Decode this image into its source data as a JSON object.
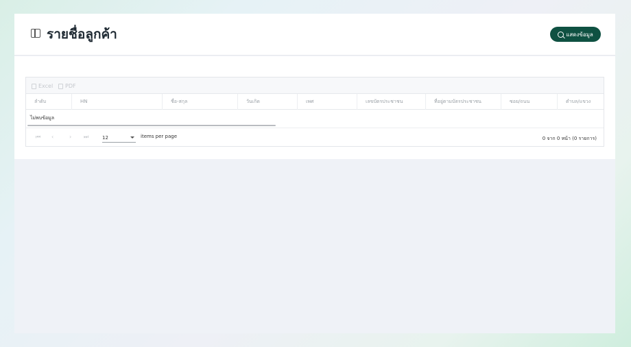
{
  "header": {
    "title": "รายชื่อลูกค้า",
    "show_button_label": "แสดงข้อมูล"
  },
  "toolbar": {
    "excel_label": "Excel",
    "pdf_label": "PDF"
  },
  "table": {
    "columns": [
      "ลำดับ",
      "HN",
      "ชื่อ-สกุล",
      "วันเกิด",
      "เพศ",
      "เลขบัตรประชาชน",
      "ที่อยู่ตามบัตรประชาชน",
      "ซอย/ถนน",
      "ตำบล/แขวง"
    ],
    "empty_message": "ไม่พบข้อมูล"
  },
  "pager": {
    "first_icon": "first-page-icon",
    "prev_icon": "prev-page-icon",
    "next_icon": "next-page-icon",
    "last_icon": "last-page-icon",
    "page_size": "12",
    "items_per_page_label": "items per page",
    "info": "0 จาก 0 หน้า (0 รายการ)"
  },
  "colors": {
    "accent": "#0f5142",
    "panel": "#ffffff",
    "background": "#eff2f7"
  }
}
